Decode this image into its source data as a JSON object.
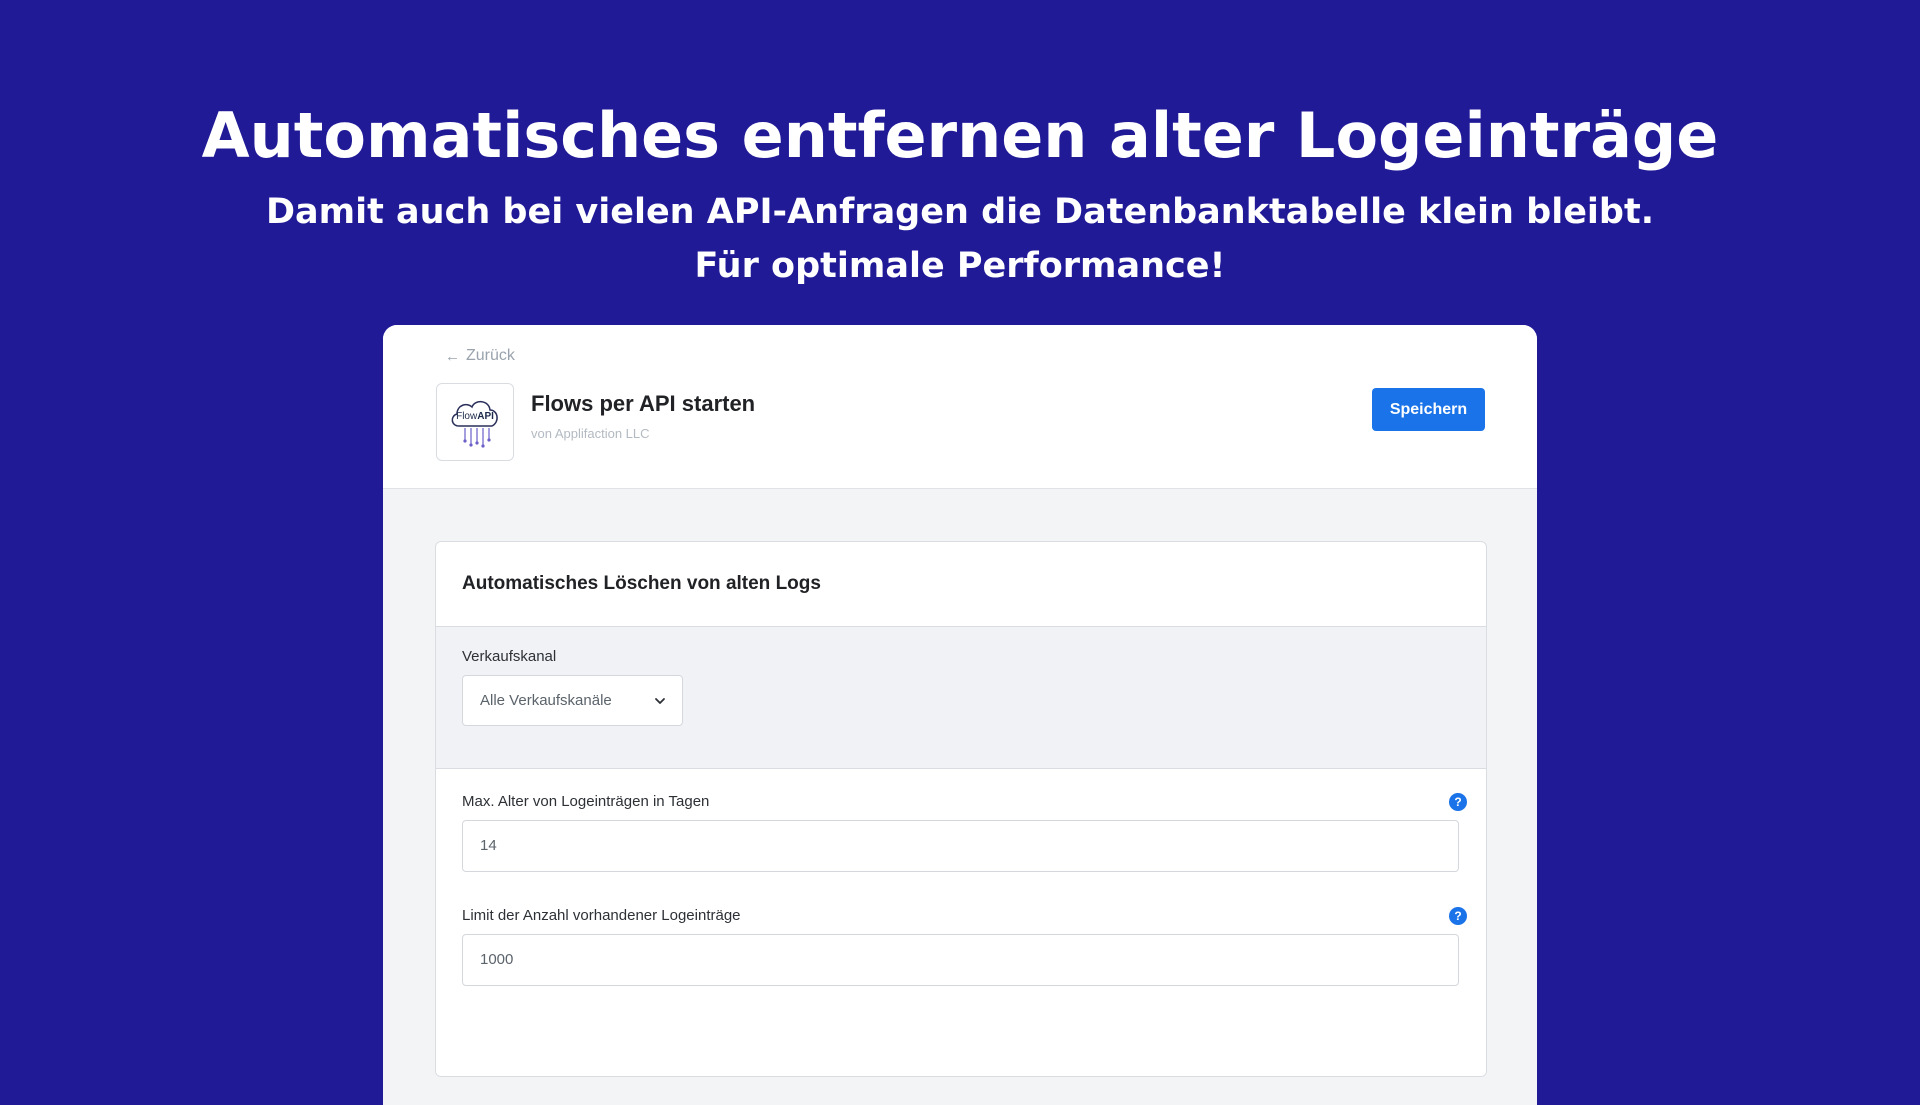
{
  "hero": {
    "title": "Automatisches entfernen alter Logeinträge",
    "subtitle_line1": "Damit auch bei vielen API-Anfragen die Datenbanktabelle klein bleibt.",
    "subtitle_line2": "Für optimale Performance!"
  },
  "colors": {
    "background": "#201a97",
    "accent": "#1a73e8"
  },
  "header": {
    "back_label": "Zurück",
    "back_icon": "arrow-left-icon",
    "app_title": "Flows per API starten",
    "app_vendor": "von Applifaction LLC",
    "logo_text_prefix": "Flow",
    "logo_text_suffix": "API",
    "logo_icon": "cloud-icon",
    "save_label": "Speichern"
  },
  "settings": {
    "card_title": "Automatisches Löschen von alten Logs",
    "channel": {
      "label": "Verkaufskanal",
      "selected": "Alle Verkaufskanäle",
      "icon": "chevron-down-icon"
    },
    "max_age": {
      "label": "Max. Alter von Logeinträgen in Tagen",
      "value": "14",
      "help": "?"
    },
    "max_count": {
      "label": "Limit der Anzahl vorhandener Logeinträge",
      "value": "1000",
      "help": "?"
    }
  }
}
